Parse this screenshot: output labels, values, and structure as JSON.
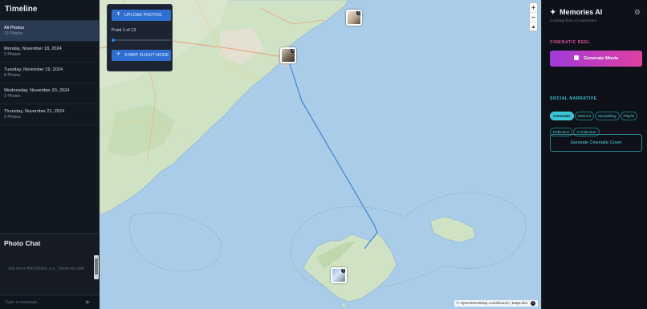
{
  "timeline": {
    "title": "Timeline",
    "items": [
      {
        "date": "All Photos",
        "count": "13 Photos"
      },
      {
        "date": "Monday, November 18, 2024",
        "count": "3 Photos"
      },
      {
        "date": "Tuesday, November 19, 2024",
        "count": "6 Photos"
      },
      {
        "date": "Wednesday, November 20, 2024",
        "count": "2 Photos"
      },
      {
        "date": "Thursday, November 21, 2024",
        "count": "2 Photos"
      }
    ]
  },
  "chat": {
    "title": "Photo Chat",
    "hint": "Ask me to find photos, e.g., 'Show me cafe'",
    "input_placeholder": "Type a message...",
    "send_icon": "send-icon"
  },
  "map_controls": {
    "upload_label": "UPLOAD PHOTOS",
    "point_text": "Point 1 of 13",
    "point_progress": 0.0,
    "flight_label": "START FLIGHT MODE",
    "zoom_in": "+",
    "zoom_out": "−",
    "compass": "▲"
  },
  "attribution": "© OpenStreetMap contributors | MapLibre",
  "brand": {
    "name": "Memories AI",
    "subtitle": "Curating from 13 memories",
    "settings_icon": "gear-icon"
  },
  "cinematic": {
    "section_label": "CINEMATIC REEL",
    "button_label": "Generate Movie"
  },
  "narrative": {
    "section_label": "SOCIAL NARRATIVE",
    "styles": [
      "Cinematic",
      "Minimal",
      "Storytelling",
      "Playful",
      "Reflective",
      "Architecture"
    ],
    "selected": "Cinematic",
    "cover_button": "Generate Cinematic Cover"
  },
  "colors": {
    "accent_blue": "#2f6fd1",
    "pink": "#e0529f",
    "teal": "#3cc7d6",
    "route": "#3a7bd5"
  }
}
